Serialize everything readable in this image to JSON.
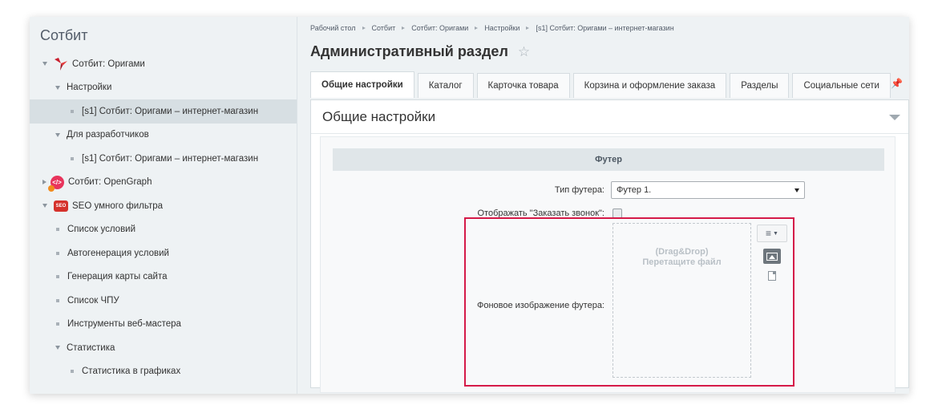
{
  "sidebar": {
    "title": "Сотбит",
    "items": [
      {
        "label": "Сотбит: Оригами"
      },
      {
        "label": "Настройки"
      },
      {
        "label": "[s1] Сотбит: Оригами – интернет-магазин"
      },
      {
        "label": "Для разработчиков"
      },
      {
        "label": "[s1] Сотбит: Оригами – интернет-магазин"
      },
      {
        "label": "Сотбит: OpenGraph"
      },
      {
        "label": "SEO умного фильтра"
      },
      {
        "label": "Список условий"
      },
      {
        "label": "Автогенерация условий"
      },
      {
        "label": "Генерация карты сайта"
      },
      {
        "label": "Список ЧПУ"
      },
      {
        "label": "Инструменты веб-мастера"
      },
      {
        "label": "Статистика"
      },
      {
        "label": "Статистика в графиках"
      }
    ]
  },
  "breadcrumb": [
    "Рабочий стол",
    "Сотбит",
    "Сотбит: Оригами",
    "Настройки",
    "[s1] Сотбит: Оригами – интернет-магазин"
  ],
  "page_title": "Административный раздел",
  "tabs": [
    {
      "label": "Общие настройки"
    },
    {
      "label": "Каталог"
    },
    {
      "label": "Карточка товара"
    },
    {
      "label": "Корзина и оформление заказа"
    },
    {
      "label": "Разделы"
    },
    {
      "label": "Социальные сети"
    }
  ],
  "panel": {
    "title": "Общие настройки",
    "section": "Футер",
    "footer_type_label": "Тип футера:",
    "footer_type_value": "Футер 1.",
    "callback_label": "Отображать \"Заказать звонок\":",
    "background_label": "Фоновое изображение футера:",
    "dropzone_line1": "(Drag&Drop)",
    "dropzone_line2": "Перетащите файл"
  },
  "colors": {
    "highlight": "#d51a48",
    "sidebar_bg": "#eef2f4"
  }
}
